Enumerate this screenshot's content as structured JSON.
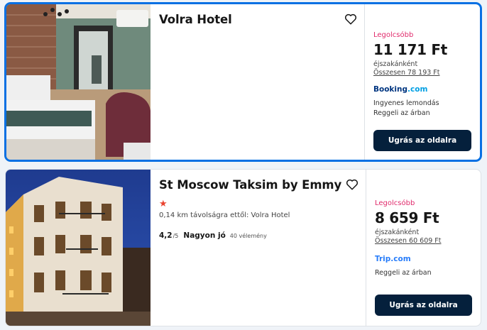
{
  "hotels": [
    {
      "name": "Volra Hotel",
      "cheapest_label": "Legolcsóbb",
      "price": "11 171 Ft",
      "per_night": "éjszakánként",
      "total": "Összesen 78 193 Ft",
      "provider_part1": "Booking",
      "provider_part2": ".com",
      "features": [
        "Ingyenes lemondás",
        "Reggeli az árban"
      ],
      "cta": "Ugrás az oldalra",
      "favorite_icon": "heart-icon"
    },
    {
      "name": "St Moscow Taksim by Emmy",
      "stars": "★",
      "star_count": 1,
      "distance": "0,14 km távolságra ettől: Volra Hotel",
      "rating_score": "4,2",
      "rating_scale": "/5",
      "rating_word": "Nagyon jó",
      "rating_reviews": "40 vélemény",
      "cheapest_label": "Legolcsóbb",
      "price": "8 659 Ft",
      "per_night": "éjszakánként",
      "total": "Összesen 60 609 Ft",
      "provider": "Trip.com",
      "features": [
        "Reggeli az árban"
      ],
      "cta": "Ugrás az oldalra",
      "favorite_icon": "heart-icon"
    }
  ],
  "colors": {
    "selected_border": "#0770e3",
    "cheapest": "#e02a6b",
    "cta_bg": "#05203c",
    "star": "#e9422f",
    "booking_dark": "#003580",
    "booking_light": "#009fe3",
    "trip": "#287dfa"
  }
}
